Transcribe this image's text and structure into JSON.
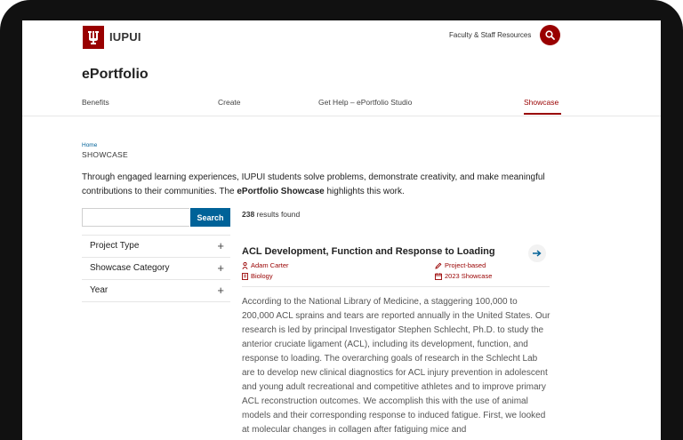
{
  "header": {
    "logo_text": "IUPUI",
    "utility_link": "Faculty & Staff Resources",
    "site_title": "ePortfolio"
  },
  "nav": {
    "items": [
      {
        "label": "Benefits"
      },
      {
        "label": "Create"
      },
      {
        "label": "Get Help – ePortfolio Studio"
      },
      {
        "label": "Showcase",
        "active": true
      }
    ]
  },
  "breadcrumb": {
    "home": "Home",
    "current": "SHOWCASE"
  },
  "intro": {
    "text_before": "Through engaged learning experiences, IUPUI students solve problems, demonstrate creativity, and make meaningful contributions to their communities. The ",
    "bold": "ePortfolio Showcase",
    "text_after": " highlights this work."
  },
  "search": {
    "placeholder": "",
    "value": "",
    "button_label": "Search"
  },
  "filters": [
    {
      "label": "Project Type",
      "toggle": "+"
    },
    {
      "label": "Showcase Category",
      "toggle": "+"
    },
    {
      "label": "Year",
      "toggle": "+"
    }
  ],
  "results": {
    "count": "238",
    "count_suffix": " results found",
    "items": [
      {
        "title": "ACL Development, Function and Response to Loading",
        "author": "Adam Carter",
        "department": "Biology",
        "project_type": "Project-based",
        "showcase": "2023 Showcase",
        "body": "According to the National Library of Medicine, a staggering 100,000 to 200,000 ACL sprains and tears are reported annually in the United States. Our research is led by principal Investigator Stephen Schlecht, Ph.D. to study the anterior cruciate ligament (ACL), including its development, function, and response to loading. The overarching goals of research in the Schlecht Lab are to develop new clinical diagnostics for ACL injury prevention in adolescent and young adult recreational and competitive athletes and to improve primary ACL reconstruction outcomes. We accomplish this with the use of animal models and their corresponding response to induced fatigue. First, we looked at molecular changes in collagen after fatiguing mice and"
      }
    ]
  },
  "colors": {
    "brand_red": "#990000",
    "link_blue": "#006298"
  }
}
